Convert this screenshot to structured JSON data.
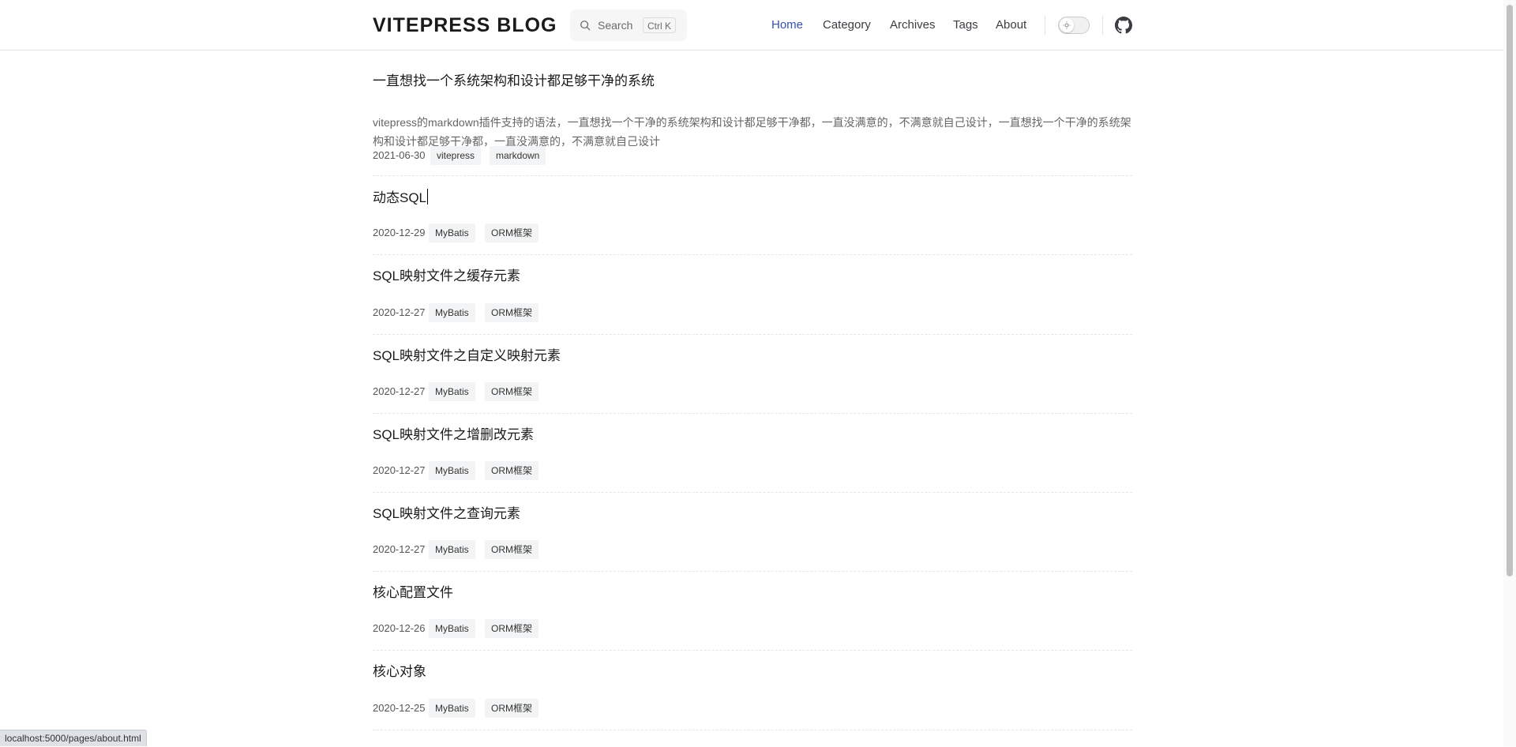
{
  "header": {
    "logo": "VITEPRESS BLOG",
    "search": {
      "label": "Search",
      "shortcut": "Ctrl K"
    },
    "nav": [
      {
        "label": "Home",
        "active": true
      },
      {
        "label": "Category"
      },
      {
        "label": "Archives"
      },
      {
        "label": "Tags"
      },
      {
        "label": "About"
      }
    ],
    "accent_color": "#3451b2"
  },
  "posts": [
    {
      "title": "一直想找一个系统架构和设计都足够干净的系统",
      "excerpt": "vitepress的markdown插件支持的语法，一直想找一个干净的系统架构和设计都足够干净都，一直没满意的，不满意就自己设计，一直想找一个干净的系统架构和设计都足够干净都，一直没满意的，不满意就自己设计",
      "date": "2021-06-30",
      "tags": [
        "vitepress",
        "markdown"
      ]
    },
    {
      "title": "动态SQL",
      "date": "2020-12-29",
      "tags": [
        "MyBatis",
        "ORM框架"
      ]
    },
    {
      "title": "SQL映射文件之缓存元素",
      "date": "2020-12-27",
      "tags": [
        "MyBatis",
        "ORM框架"
      ]
    },
    {
      "title": "SQL映射文件之自定义映射元素",
      "date": "2020-12-27",
      "tags": [
        "MyBatis",
        "ORM框架"
      ]
    },
    {
      "title": "SQL映射文件之增删改元素",
      "date": "2020-12-27",
      "tags": [
        "MyBatis",
        "ORM框架"
      ]
    },
    {
      "title": "SQL映射文件之查询元素",
      "date": "2020-12-27",
      "tags": [
        "MyBatis",
        "ORM框架"
      ]
    },
    {
      "title": "核心配置文件",
      "date": "2020-12-26",
      "tags": [
        "MyBatis",
        "ORM框架"
      ]
    },
    {
      "title": "核心对象",
      "date": "2020-12-25",
      "tags": [
        "MyBatis",
        "ORM框架"
      ]
    }
  ],
  "status_bar": {
    "url": "localhost:5000/pages/about.html"
  }
}
